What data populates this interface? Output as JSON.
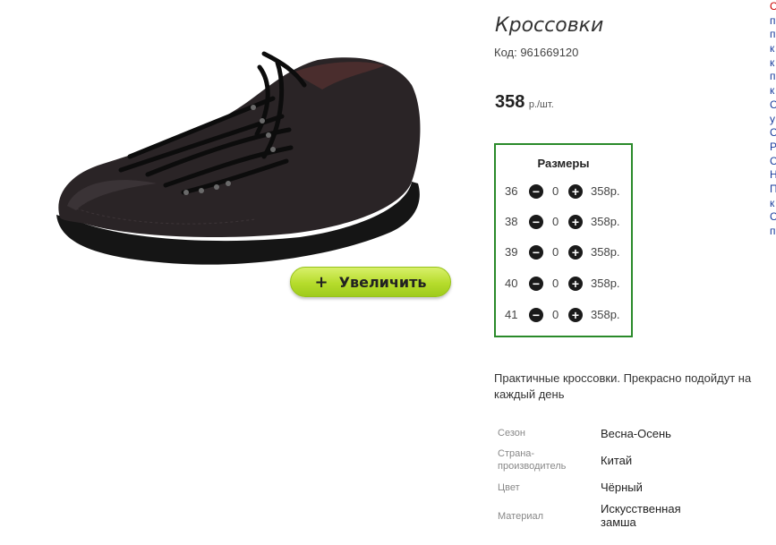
{
  "product": {
    "title": "Кроссовки",
    "code": "Код: 961669120",
    "price": "358",
    "price_unit": "р./шт."
  },
  "zoom_button": {
    "label": "Увеличить",
    "icon": "plus-icon"
  },
  "sizes": {
    "title": "Размеры",
    "rows": [
      {
        "size": "36",
        "qty": "0",
        "price": "358р."
      },
      {
        "size": "38",
        "qty": "0",
        "price": "358р."
      },
      {
        "size": "39",
        "qty": "0",
        "price": "358р."
      },
      {
        "size": "40",
        "qty": "0",
        "price": "358р."
      },
      {
        "size": "41",
        "qty": "0",
        "price": "358р."
      }
    ]
  },
  "description": "Практичные кроссовки. Прекрасно подойдут на каждый день",
  "attributes": [
    {
      "label": "Сезон",
      "value": "Весна-Осень"
    },
    {
      "label": "Страна-производитель",
      "value": "Китай"
    },
    {
      "label": "Цвет",
      "value": "Чёрный"
    },
    {
      "label": "Материал",
      "value": "Искусственная замша"
    }
  ],
  "right_column_letters": [
    "С",
    "п",
    "п",
    "к",
    "к",
    "п",
    "к",
    "С",
    "у",
    "С",
    "Р",
    "С",
    "Н",
    "П",
    "к",
    "С",
    "п"
  ],
  "colors": {
    "sizes_border": "#2a8a2a",
    "button_green": "#b6dc2c",
    "link_red": "#cc0000",
    "link_blue": "#1a3c9c"
  }
}
